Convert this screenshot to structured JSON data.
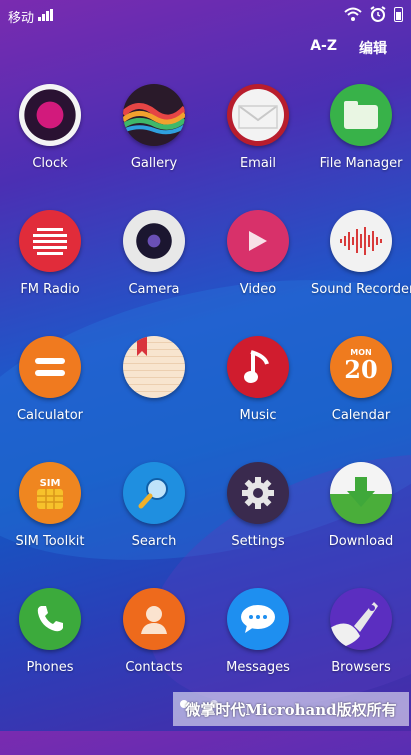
{
  "status": {
    "carrier": "移动"
  },
  "top": {
    "sort_label": "A-Z",
    "edit_label": "编辑"
  },
  "apps": [
    {
      "label": "Clock"
    },
    {
      "label": "Gallery"
    },
    {
      "label": "Email"
    },
    {
      "label": "File Manager"
    },
    {
      "label": "FM Radio"
    },
    {
      "label": "Camera"
    },
    {
      "label": "Video"
    },
    {
      "label": "Sound Recorder"
    },
    {
      "label": "Calculator"
    },
    {
      "label": "",
      "note": ""
    },
    {
      "label": "Music"
    },
    {
      "label": "Calendar"
    },
    {
      "label": "SIM Toolkit"
    },
    {
      "label": "Search"
    },
    {
      "label": "Settings"
    },
    {
      "label": "Download"
    },
    {
      "label": "Phones"
    },
    {
      "label": "Contacts"
    },
    {
      "label": "Messages"
    },
    {
      "label": "Browsers"
    }
  ],
  "calendar_icon": {
    "month": "MON",
    "day": "20"
  },
  "sim_icon": {
    "text": "SIM"
  },
  "watermark": "微掌时代Microhand版权所有"
}
